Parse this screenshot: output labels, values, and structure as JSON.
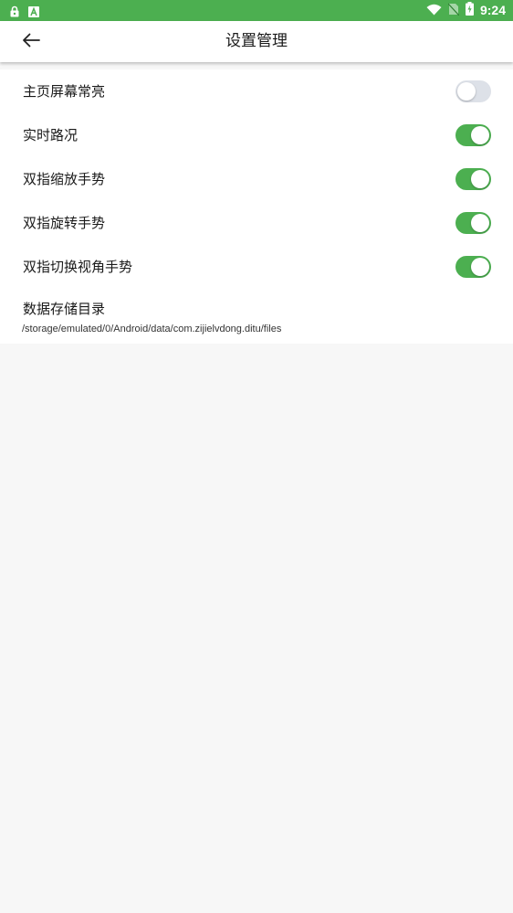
{
  "status_bar": {
    "time": "9:24",
    "left_icons": [
      "lock-icon",
      "a-icon"
    ],
    "right_icons": [
      "wifi-icon",
      "no-sim-icon",
      "battery-charging-icon"
    ],
    "background": "#4caf50"
  },
  "app_bar": {
    "title": "设置管理",
    "back_icon": "arrow-left-icon"
  },
  "settings": {
    "items": [
      {
        "label": "主页屏幕常亮",
        "enabled": false
      },
      {
        "label": "实时路况",
        "enabled": true
      },
      {
        "label": "双指缩放手势",
        "enabled": true
      },
      {
        "label": "双指旋转手势",
        "enabled": true
      },
      {
        "label": "双指切换视角手势",
        "enabled": true
      }
    ],
    "data_dir": {
      "title": "数据存储目录",
      "path": "/storage/emulated/0/Android/data/com.zijielvdong.ditu/files"
    }
  },
  "colors": {
    "toggle_on": "#4caf50",
    "toggle_off": "#dde1e8",
    "page_background": "#f7f7f7"
  }
}
